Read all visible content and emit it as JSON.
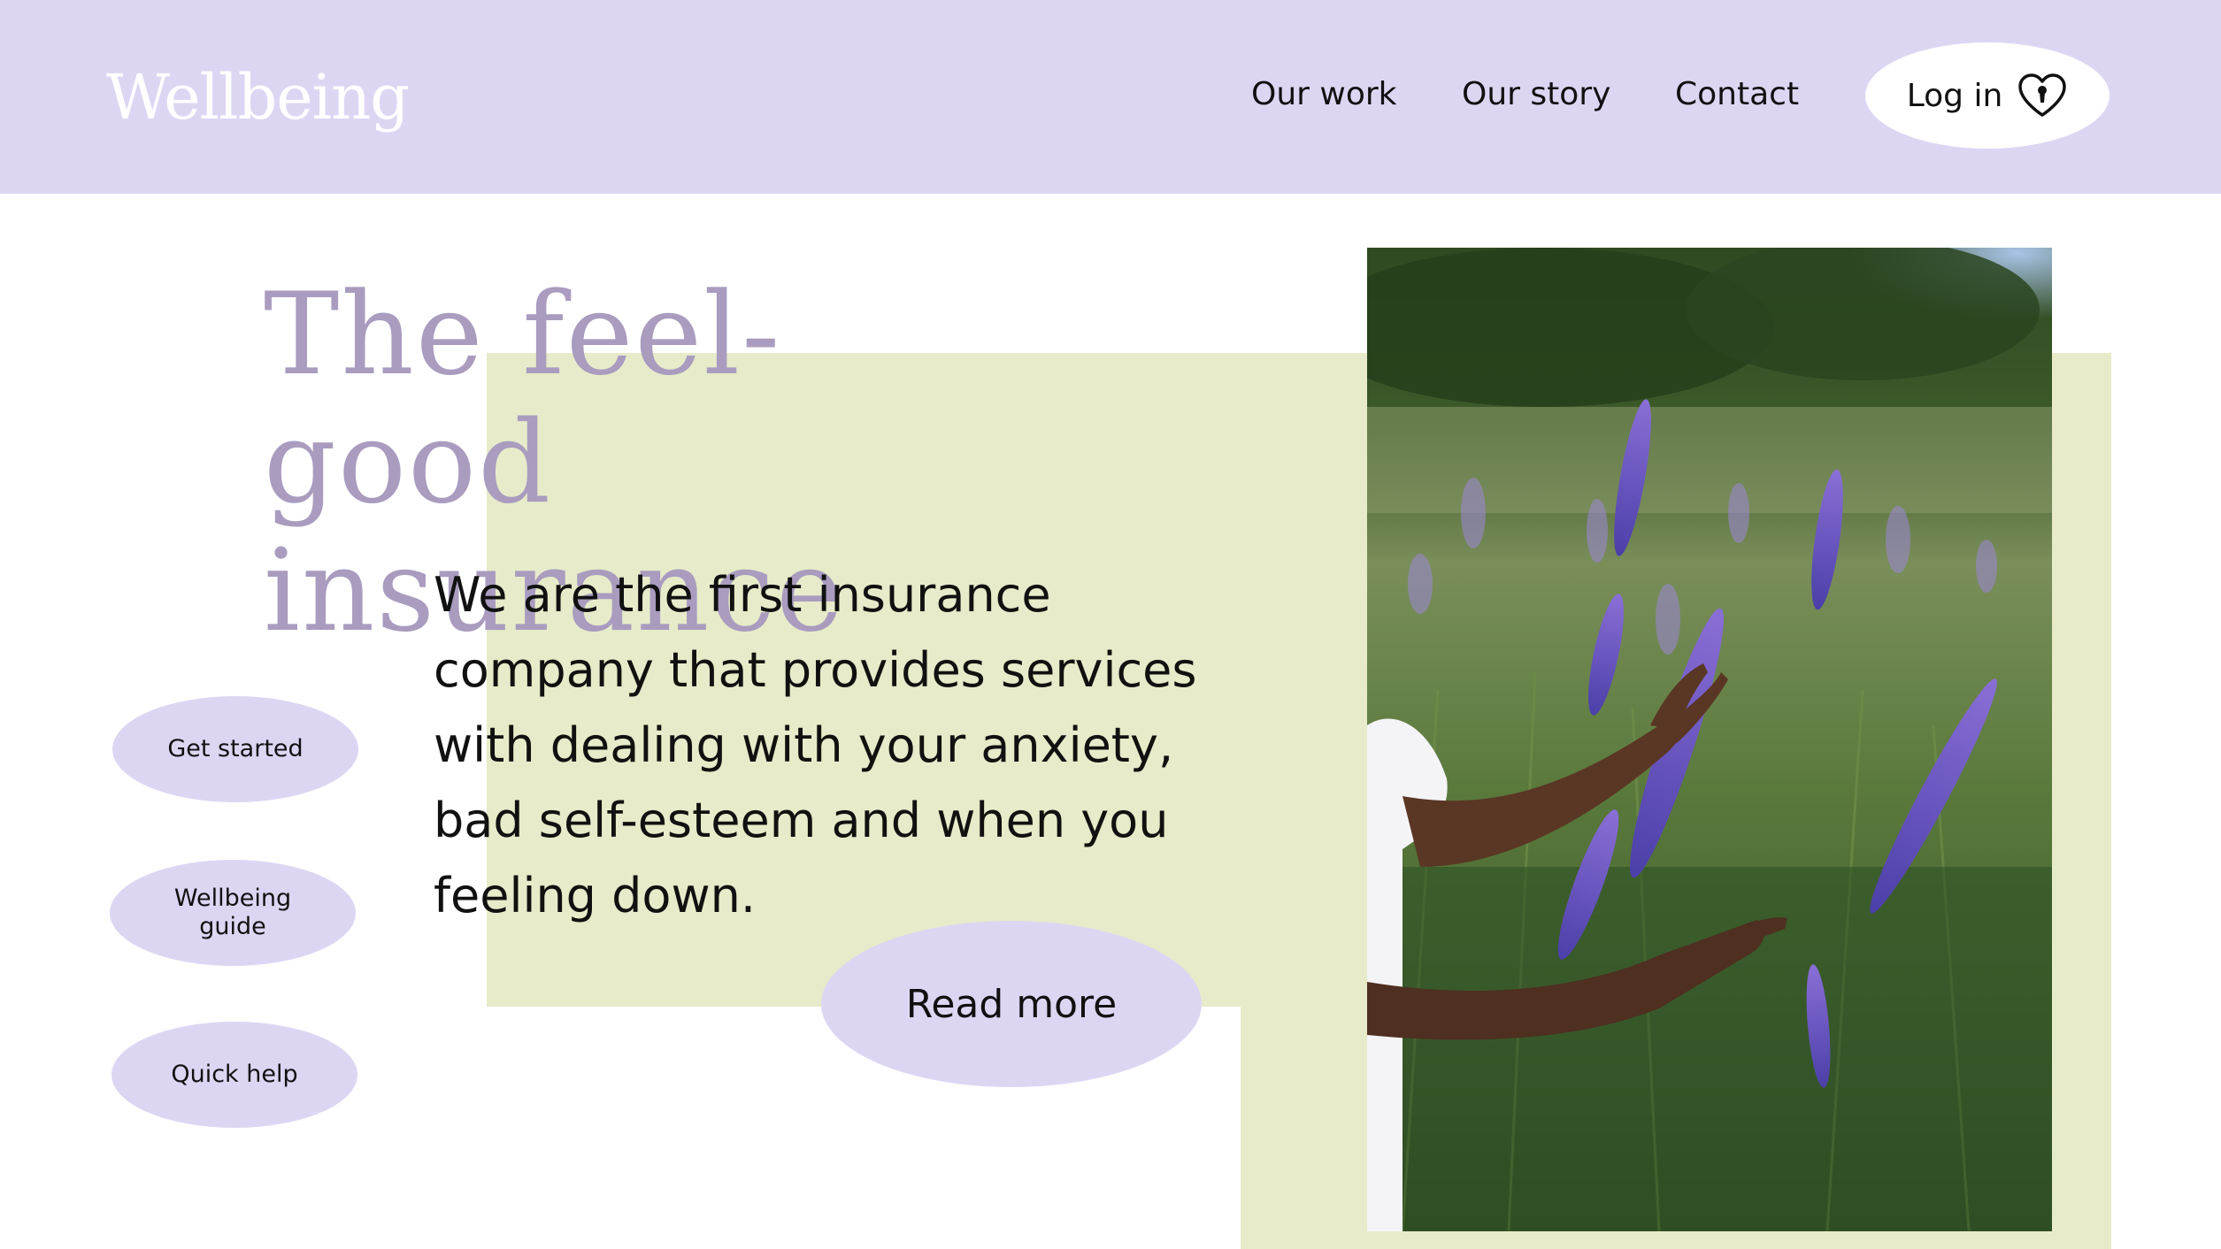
{
  "header": {
    "logo": "Wellbeing",
    "nav": [
      "Our work",
      "Our story",
      "Contact"
    ],
    "login_label": "Log in",
    "login_icon": "heart-keyhole-icon"
  },
  "hero": {
    "headline_line1": "The feel-good",
    "headline_line2": "insurance",
    "body": "We are the first insurance company that provides services with dealing with your anxiety, bad self-esteem and when you feeling down.",
    "read_more": "Read more"
  },
  "side_buttons": {
    "get_started": "Get started",
    "guide_line1": "Wellbeing",
    "guide_line2": "guide",
    "quick_help": "Quick help"
  },
  "image": {
    "subject": "hands touching purple lupine flowers in a field"
  },
  "colors": {
    "lavender": "#ddd6f3",
    "headline": "#a99cbf",
    "sage": "#e7ebc9",
    "text": "#111111"
  }
}
